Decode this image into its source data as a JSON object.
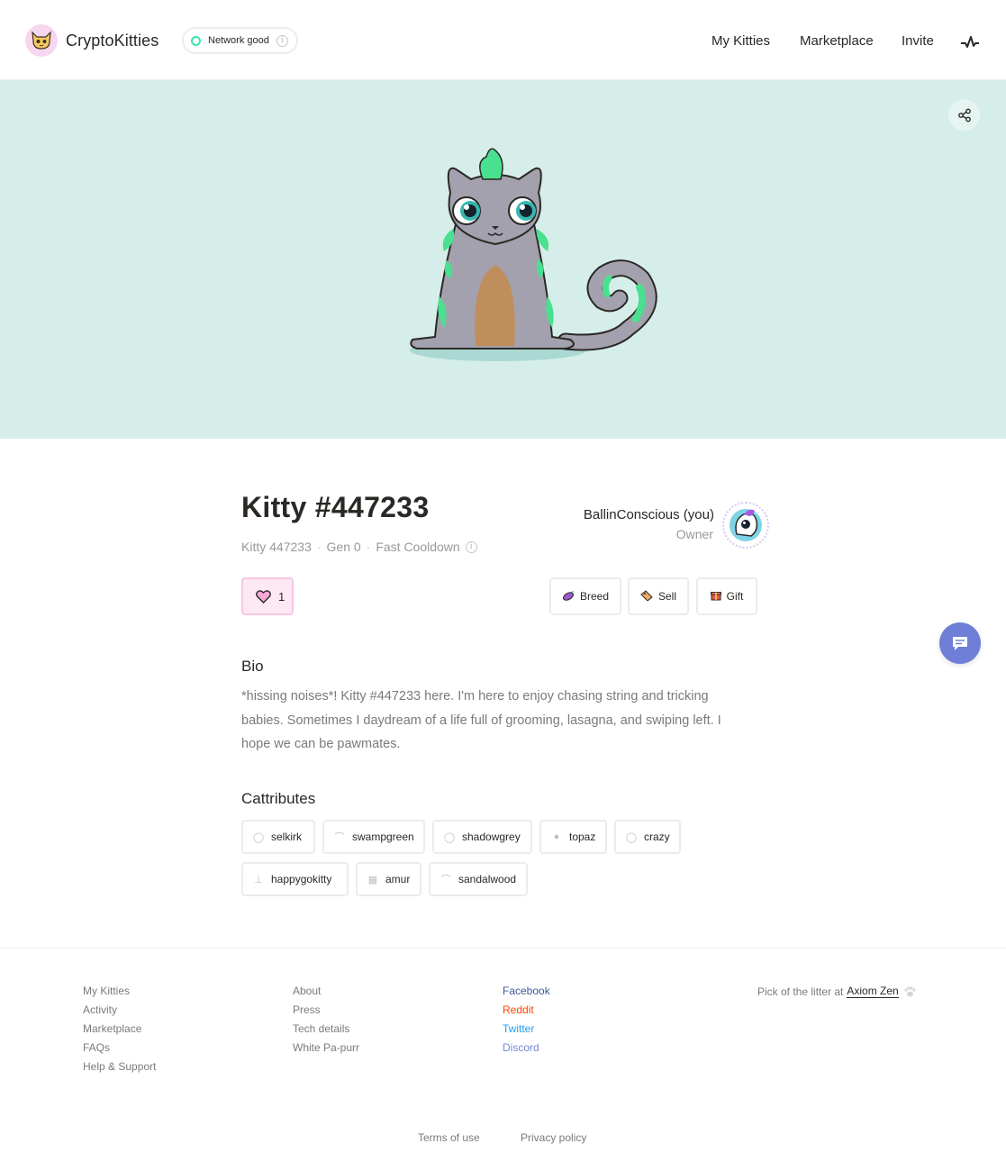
{
  "header": {
    "brand": "CryptoKitties",
    "network_status": "Network good",
    "info": "i",
    "nav": [
      "My Kitties",
      "Marketplace",
      "Invite"
    ]
  },
  "kitty": {
    "title": "Kitty #447233",
    "name": "Kitty 447233",
    "generation": "Gen 0",
    "cooldown": "Fast Cooldown",
    "likes": "1",
    "owner_name": "BallinConscious (you)",
    "owner_role": "Owner"
  },
  "actions": {
    "breed": "Breed",
    "sell": "Sell",
    "gift": "Gift"
  },
  "bio": {
    "heading": "Bio",
    "text": "*hissing noises*! Kitty #447233 here. I'm here to enjoy chasing string and tricking babies. Sometimes I daydream of a life full of grooming, lasagna, and swiping left. I hope we can be pawmates."
  },
  "cattributes": {
    "heading": "Cattributes",
    "items": [
      "selkirk",
      "swampgreen",
      "shadowgrey",
      "topaz",
      "crazy",
      "happygokitty",
      "amur",
      "sandalwood"
    ]
  },
  "footer": {
    "col1": [
      "My Kitties",
      "Activity",
      "Marketplace",
      "FAQs",
      "Help & Support"
    ],
    "col2": [
      "About",
      "Press",
      "Tech details",
      "White Pa-purr"
    ],
    "col3": [
      "Facebook",
      "Reddit",
      "Twitter",
      "Discord"
    ],
    "litter_prefix": "Pick of the litter at",
    "litter_brand": "Axiom Zen",
    "terms": "Terms of use",
    "privacy": "Privacy policy"
  },
  "colors": {
    "hero_bg": "#d5eeea",
    "network_dot": "#3de6a6",
    "facebook": "#3b5998",
    "reddit": "#ff4500",
    "twitter": "#1da1f2",
    "discord": "#7289da",
    "chat": "#6f7fd8"
  }
}
